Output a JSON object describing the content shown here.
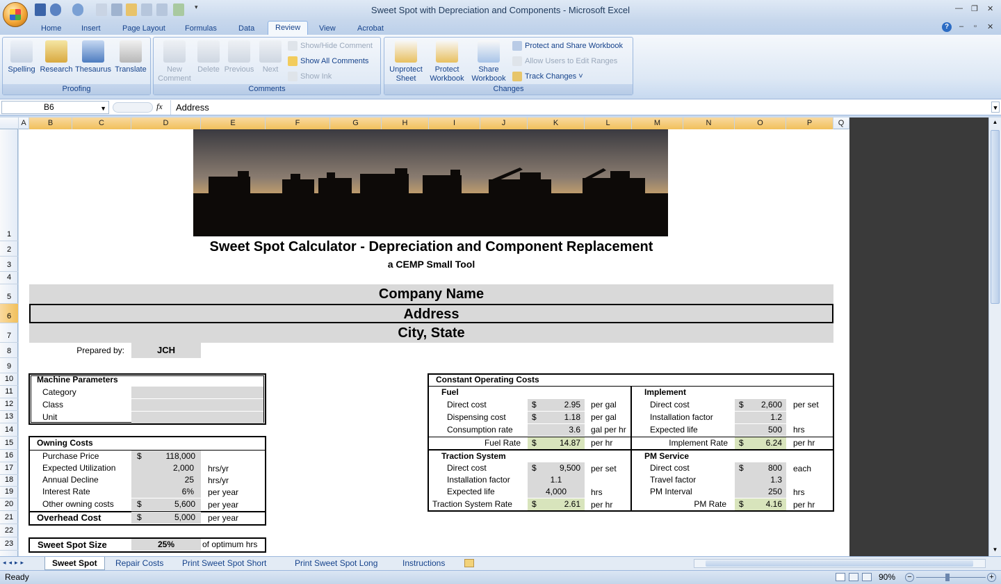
{
  "window": {
    "title_doc": "Sweet Spot with Depreciation and Components",
    "title_sep": " - ",
    "title_app": "Microsoft Excel"
  },
  "tabs": [
    "Home",
    "Insert",
    "Page Layout",
    "Formulas",
    "Data",
    "Review",
    "View",
    "Acrobat"
  ],
  "ribbon": {
    "proofing": {
      "label": "Proofing",
      "spelling": "Spelling",
      "research": "Research",
      "thesaurus": "Thesaurus",
      "translate": "Translate"
    },
    "comments": {
      "label": "Comments",
      "new_comment_1": "New",
      "new_comment_2": "Comment",
      "delete": "Delete",
      "previous": "Previous",
      "next": "Next",
      "show_hide": "Show/Hide Comment",
      "show_all": "Show All Comments",
      "show_ink": "Show Ink"
    },
    "changes": {
      "label": "Changes",
      "unprotect_1": "Unprotect",
      "unprotect_2": "Sheet",
      "protect_1": "Protect",
      "protect_2": "Workbook",
      "share_1": "Share",
      "share_2": "Workbook",
      "protect_share": "Protect and Share Workbook",
      "allow_users": "Allow Users to Edit Ranges",
      "track_changes": "Track Changes ˅"
    }
  },
  "formula_bar": {
    "name_box": "B6",
    "fx": "fx",
    "value": "Address"
  },
  "columns": [
    "A",
    "B",
    "C",
    "D",
    "E",
    "F",
    "G",
    "H",
    "I",
    "J",
    "K",
    "L",
    "M",
    "N",
    "O",
    "P",
    "Q"
  ],
  "rows": [
    "1",
    "2",
    "3",
    "4",
    "5",
    "6",
    "7",
    "8",
    "9",
    "10",
    "11",
    "12",
    "13",
    "14",
    "15",
    "16",
    "17",
    "18",
    "19",
    "20",
    "21",
    "22",
    "23"
  ],
  "sheet": {
    "title": "Sweet Spot Calculator - Depreciation and Component Replacement",
    "subtitle": "a CEMP Small Tool",
    "company": "Company Name",
    "address": "Address",
    "city": "City, State",
    "prepared_label": "Prepared by:",
    "prepared_value": "JCH",
    "machine": {
      "header": "Machine Parameters",
      "category": "Category",
      "class": "Class",
      "unit": "Unit"
    },
    "owning": {
      "header": "Owning Costs",
      "purchase_label": "Purchase Price",
      "purchase_cur": "$",
      "purchase_val": "118,000",
      "util_label": "Expected Utilization",
      "util_val": "2,000",
      "util_unit": "hrs/yr",
      "decline_label": "Annual Decline",
      "decline_val": "25",
      "decline_unit": "hrs/yr",
      "interest_label": "Interest Rate",
      "interest_val": "6%",
      "interest_unit": "per year",
      "other_label": "Other owning costs",
      "other_cur": "$",
      "other_val": "5,600",
      "other_unit": "per year",
      "overhead_label": "Overhead Cost",
      "overhead_cur": "$",
      "overhead_val": "5,000",
      "overhead_unit": "per year"
    },
    "sweet": {
      "label": "Sweet Spot Size",
      "value": "25%",
      "unit": "of optimum hrs"
    },
    "constant": {
      "header": "Constant Operating Costs",
      "fuel": {
        "header": "Fuel",
        "direct_label": "Direct cost",
        "direct_cur": "$",
        "direct_val": "2.95",
        "direct_unit": "per gal",
        "disp_label": "Dispensing cost",
        "disp_cur": "$",
        "disp_val": "1.18",
        "disp_unit": "per gal",
        "cons_label": "Consumption rate",
        "cons_val": "3.6",
        "cons_unit": "gal per hr",
        "rate_label": "Fuel Rate",
        "rate_cur": "$",
        "rate_val": "14.87",
        "rate_unit": "per hr"
      },
      "implement": {
        "header": "Implement",
        "direct_label": "Direct cost",
        "direct_cur": "$",
        "direct_val": "2,600",
        "direct_unit": "per set",
        "inst_label": "Installation factor",
        "inst_val": "1.2",
        "life_label": "Expected life",
        "life_val": "500",
        "life_unit": "hrs",
        "rate_label": "Implement Rate",
        "rate_cur": "$",
        "rate_val": "6.24",
        "rate_unit": "per hr"
      },
      "traction": {
        "header": "Traction System",
        "direct_label": "Direct cost",
        "direct_cur": "$",
        "direct_val": "9,500",
        "direct_unit": "per set",
        "inst_label": "Installation factor",
        "inst_val": "1.1",
        "life_label": "Expected life",
        "life_val": "4,000",
        "life_unit": "hrs",
        "rate_label": "Traction System Rate",
        "rate_cur": "$",
        "rate_val": "2.61",
        "rate_unit": "per hr"
      },
      "pm": {
        "header": "PM Service",
        "direct_label": "Direct cost",
        "direct_cur": "$",
        "direct_val": "800",
        "direct_unit": "each",
        "travel_label": "Travel factor",
        "travel_val": "1.3",
        "interval_label": "PM Interval",
        "interval_val": "250",
        "interval_unit": "hrs",
        "rate_label": "PM Rate",
        "rate_cur": "$",
        "rate_val": "4.16",
        "rate_unit": "per hr"
      }
    }
  },
  "sheet_tabs": [
    "Sweet Spot",
    "Repair Costs",
    "Print Sweet Spot Short",
    "Print Sweet Spot Long",
    "Instructions"
  ],
  "status": {
    "ready": "Ready",
    "zoom": "90%"
  },
  "colors": {
    "banner": "#d9d9d9",
    "input": "#d9d9d9",
    "output": "#d8e4bc",
    "selected_header": "#f1c05b"
  }
}
